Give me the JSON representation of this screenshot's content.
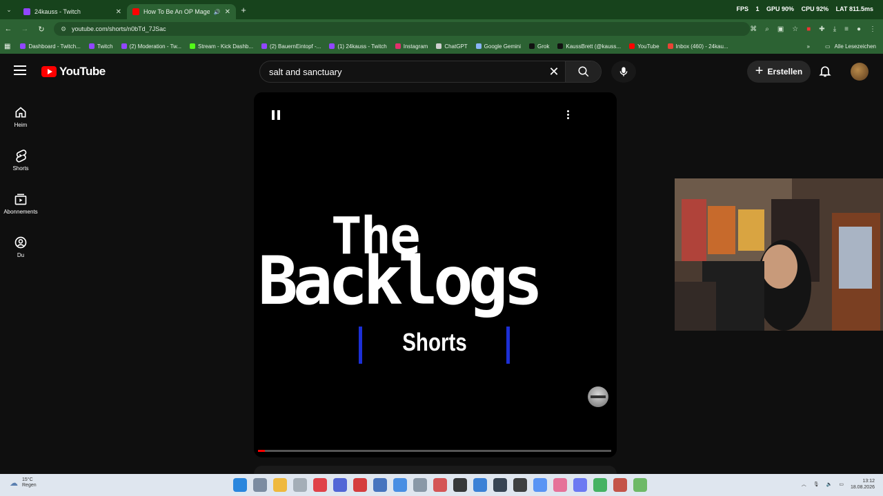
{
  "browser": {
    "tabs": [
      {
        "title": "24kauss - Twitch",
        "favicon_color": "#9146ff",
        "active": false
      },
      {
        "title": "How To Be An OP Mage Be",
        "favicon_color": "#ff0000",
        "active": true
      }
    ],
    "stats": {
      "fps_label": "FPS",
      "fps_value": "1",
      "gpu": "GPU 90%",
      "cpu": "CPU 92%",
      "lat": "LAT 811.5ms"
    },
    "url": "youtube.com/shorts/n0bTd_7JSac",
    "bookmarks": [
      {
        "label": "Dashboard - Twitch...",
        "color": "#9146ff"
      },
      {
        "label": "Twitch",
        "color": "#9146ff"
      },
      {
        "label": "(2) Moderation - Tw...",
        "color": "#9146ff"
      },
      {
        "label": "Stream - Kick Dashb...",
        "color": "#53fc18"
      },
      {
        "label": "(2) BauernEintopf -...",
        "color": "#9146ff"
      },
      {
        "label": "(1) 24kauss - Twitch",
        "color": "#9146ff"
      },
      {
        "label": "Instagram",
        "color": "#e1306c"
      },
      {
        "label": "ChatGPT",
        "color": "#cfcfcf"
      },
      {
        "label": "Google Gemini",
        "color": "#8ab4f8"
      },
      {
        "label": "Grok",
        "color": "#111111"
      },
      {
        "label": "KaussBrett (@kauss...",
        "color": "#111111"
      },
      {
        "label": "YouTube",
        "color": "#ff0000"
      },
      {
        "label": "Inbox (460) - 24kau...",
        "color": "#ea4335"
      }
    ],
    "all_bookmarks": "Alle Lesezeichen"
  },
  "youtube": {
    "logo_text": "YouTube",
    "search_query": "salt and sanctuary",
    "create_label": "Erstellen",
    "sidebar": [
      {
        "label": "Heim",
        "icon": "home-icon"
      },
      {
        "label": "Shorts",
        "icon": "shorts-icon"
      },
      {
        "label": "Abonnements",
        "icon": "subscriptions-icon"
      },
      {
        "label": "Du",
        "icon": "you-icon"
      }
    ],
    "video": {
      "title_line1": "The",
      "title_line2": "Backlogs",
      "subtitle": "Shorts",
      "progress_fraction": 0.02,
      "accent_blue": "#1c2fd6"
    }
  },
  "taskbar": {
    "weather_temp": "15°C",
    "weather_desc": "Regen",
    "time": "13:12",
    "date": "18.08.2026"
  }
}
